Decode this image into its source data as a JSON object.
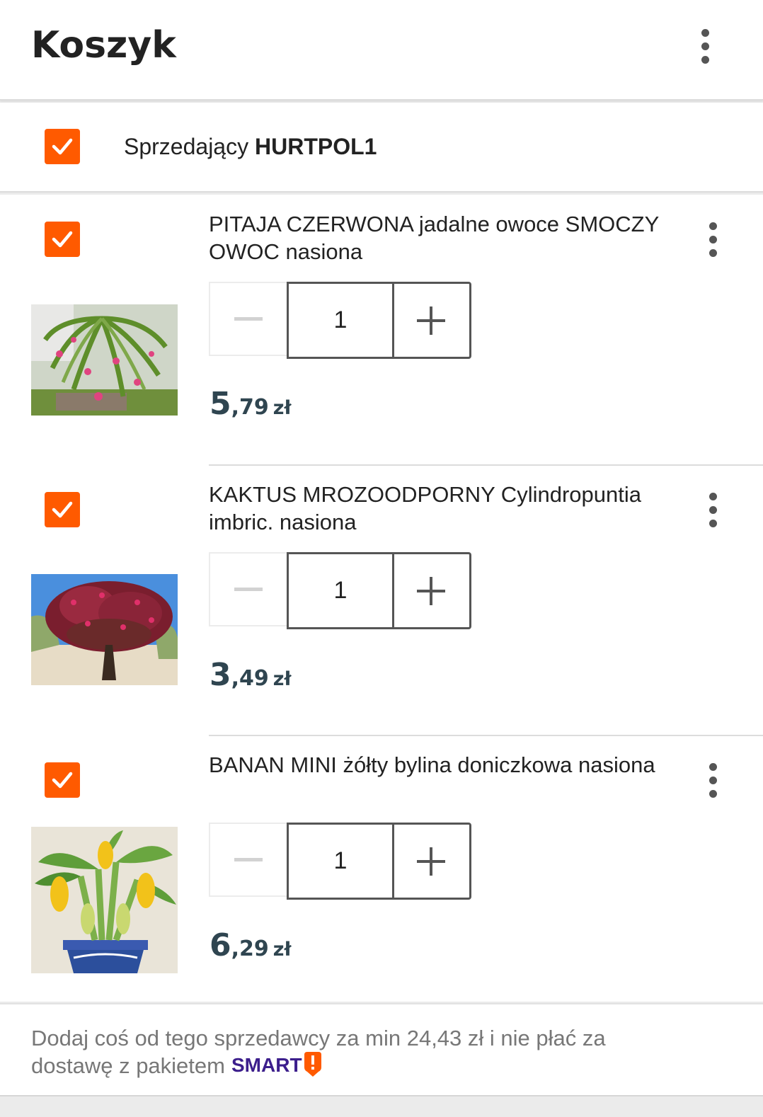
{
  "header": {
    "title": "Koszyk",
    "menu_icon": "more-vert-icon"
  },
  "seller": {
    "prefix": "Sprzedający",
    "name": "HURTPOL1",
    "checked": true
  },
  "items": [
    {
      "title": "PITAJA CZERWONA jadalne owoce SMOCZY OWOC nasiona",
      "quantity": "1",
      "price_main": "5",
      "price_fraction": ",79",
      "currency": "zł",
      "checked": true
    },
    {
      "title": "KAKTUS MROZOODPORNY Cylindropuntia imbric. nasiona",
      "quantity": "1",
      "price_main": "3",
      "price_fraction": ",49",
      "currency": "zł",
      "checked": true
    },
    {
      "title": "BANAN MINI żółty bylina doniczkowa nasiona",
      "quantity": "1",
      "price_main": "6",
      "price_fraction": ",29",
      "currency": "zł",
      "checked": true
    }
  ],
  "footer": {
    "text": "Dodaj coś od tego sprzedawcy za min 24,43 zł i nie płać za dostawę z pakietem",
    "smart_label": "SMART"
  },
  "colors": {
    "accent": "#ff5a00",
    "price": "#2f4550",
    "smart": "#3c1e8c"
  }
}
